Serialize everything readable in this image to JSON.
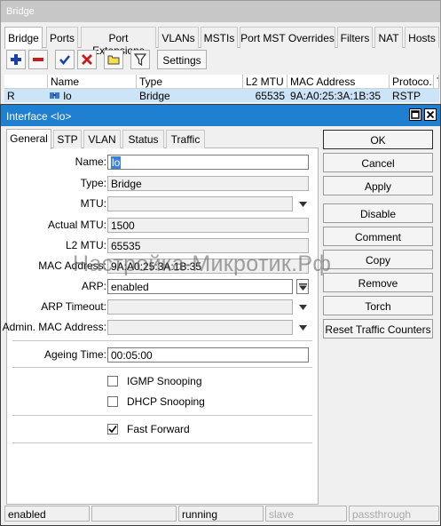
{
  "bridge_window": {
    "title": "Bridge",
    "tabs": [
      "Bridge",
      "Ports",
      "Port Extensions",
      "VLANs",
      "MSTIs",
      "Port MST Overrides",
      "Filters",
      "NAT",
      "Hosts"
    ],
    "settings_label": "Settings",
    "table": {
      "columns": [
        "Name",
        "Type",
        "L2 MTU",
        "MAC Address",
        "Protoco...",
        "T"
      ],
      "rows": [
        {
          "flag": "R",
          "name": "lo",
          "type": "Bridge",
          "l2mtu": "65535",
          "mac": "9A:A0:25:3A:1B:35",
          "protocol": "RSTP"
        }
      ]
    }
  },
  "interface_window": {
    "title": "Interface <lo>",
    "tabs": [
      "General",
      "STP",
      "VLAN",
      "Status",
      "Traffic"
    ],
    "fields": {
      "name": {
        "label": "Name:",
        "value": "lo"
      },
      "type": {
        "label": "Type:",
        "value": "Bridge"
      },
      "mtu": {
        "label": "MTU:",
        "value": ""
      },
      "actual_mtu": {
        "label": "Actual MTU:",
        "value": "1500"
      },
      "l2_mtu": {
        "label": "L2 MTU:",
        "value": "65535"
      },
      "mac_address": {
        "label": "MAC Address:",
        "value": "9A:A0:25:3A:1B:35"
      },
      "arp": {
        "label": "ARP:",
        "value": "enabled"
      },
      "arp_timeout": {
        "label": "ARP Timeout:",
        "value": ""
      },
      "admin_mac": {
        "label": "Admin. MAC Address:",
        "value": ""
      },
      "ageing_time": {
        "label": "Ageing Time:",
        "value": "00:05:00"
      }
    },
    "checkboxes": {
      "igmp_snooping": {
        "label": "IGMP Snooping",
        "checked": false
      },
      "dhcp_snooping": {
        "label": "DHCP Snooping",
        "checked": false
      },
      "fast_forward": {
        "label": "Fast Forward",
        "checked": true
      }
    },
    "buttons": {
      "ok": "OK",
      "cancel": "Cancel",
      "apply": "Apply",
      "disable": "Disable",
      "comment": "Comment",
      "copy": "Copy",
      "remove": "Remove",
      "torch": "Torch",
      "reset_traffic": "Reset Traffic Counters"
    },
    "status_bar": [
      "enabled",
      "",
      "running",
      "slave",
      "passthrough"
    ]
  },
  "watermark": "Настройка-Микротик.Рф",
  "colors": {
    "dialog_titlebar": "#1f7fd0",
    "selected_row": "#cce4f7",
    "add_icon": "#1a3fa8",
    "remove_icon": "#c81c1c",
    "enable_icon": "#1a3fa8",
    "disable_icon": "#c81c1c"
  },
  "icons": [
    "add-icon",
    "remove-icon",
    "enable-icon",
    "disable-icon",
    "comment-icon",
    "filter-icon",
    "bridge-icon",
    "maximize-icon",
    "close-icon",
    "chevron-down-icon"
  ]
}
